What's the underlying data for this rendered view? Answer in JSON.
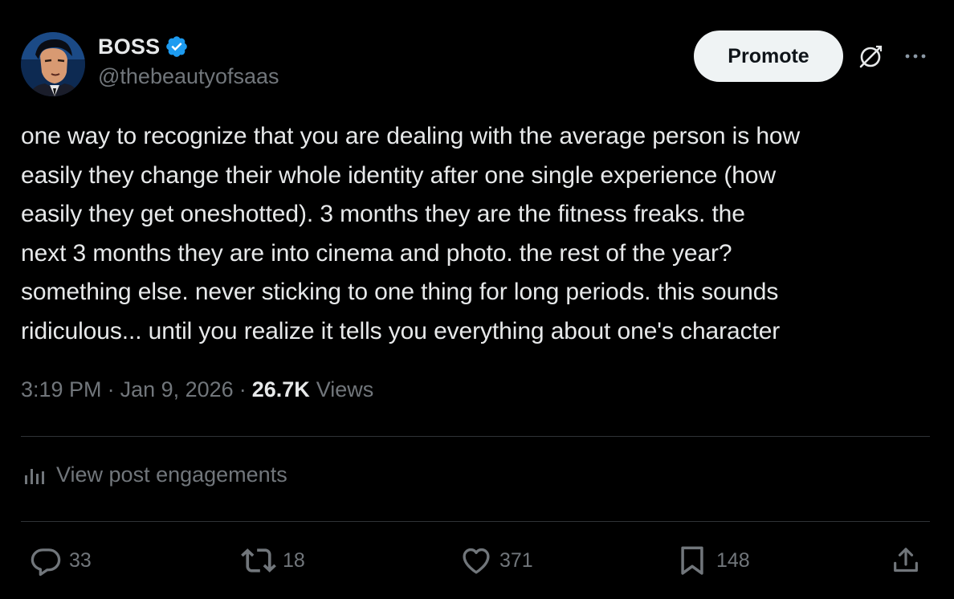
{
  "author": {
    "display_name": "BOSS",
    "handle": "@thebeautyofsaas",
    "verified": true
  },
  "header": {
    "promote_label": "Promote",
    "icons": [
      "grok-icon",
      "more-icon"
    ]
  },
  "post": {
    "text": "one way to recognize that you are dealing with the average person is how\neasily they change their whole identity after one single experience (how\neasily they get oneshotted). 3 months they are the fitness freaks. the\nnext 3 months they are into cinema and photo. the rest of the year?\nsomething else. never sticking to one thing for long periods. this sounds\nridiculous... until you realize it tells you everything about one's character",
    "time": "3:19 PM",
    "separator": "·",
    "date": "Jan 9, 2026",
    "views_count": "26.7K",
    "views_label": "Views"
  },
  "engagements": {
    "label": "View post engagements"
  },
  "actions": {
    "replies": "33",
    "reposts": "18",
    "likes": "371",
    "bookmarks": "148"
  },
  "colors": {
    "background": "#000000",
    "text": "#e7e9ea",
    "muted": "#71767b",
    "verified": "#1d9bf0",
    "divider": "#2f3336",
    "button_bg": "#eff3f4"
  }
}
